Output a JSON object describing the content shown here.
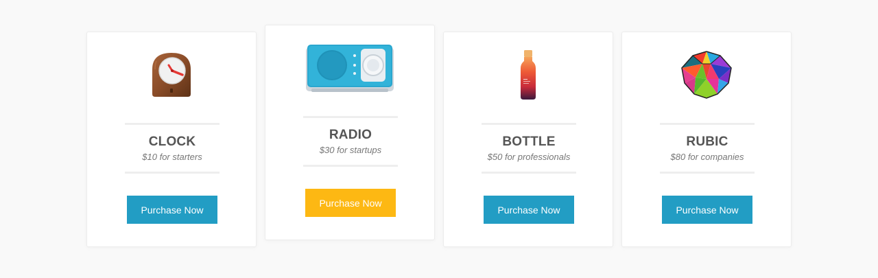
{
  "colors": {
    "button_default": "#229dc4",
    "button_featured": "#fdb813",
    "divider": "#eeeeee",
    "page_background": "#f9f9f9"
  },
  "plans": [
    {
      "name": "CLOCK",
      "price": "$10 for starters",
      "button_label": "Purchase Now",
      "image": "wooden-clock-icon",
      "featured": false
    },
    {
      "name": "RADIO",
      "price": "$30 for startups",
      "button_label": "Purchase Now",
      "image": "blue-radio-icon",
      "featured": true
    },
    {
      "name": "BOTTLE",
      "price": "$50 for professionals",
      "button_label": "Purchase Now",
      "image": "gradient-bottle-icon",
      "featured": false
    },
    {
      "name": "RUBIC",
      "price": "$80 for companies",
      "button_label": "Purchase Now",
      "image": "colorful-polyhedron-icon",
      "featured": false
    }
  ]
}
